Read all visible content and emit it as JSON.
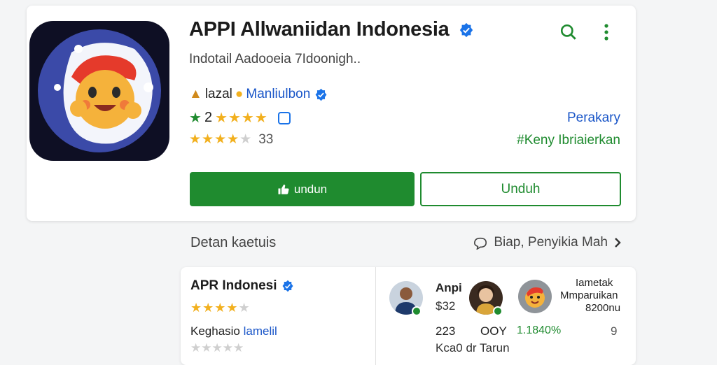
{
  "app": {
    "title": "APPI Allwaniidan Indonesia",
    "subtitle": "Indotail  Aadooeia  7Idoonigh..",
    "developer_prefix": "lazal",
    "developer_name": "Manliulbon",
    "rating_value": "2",
    "rating_stars": "★★★★",
    "rating2_stars": "★★★★",
    "rating2_empty": "★",
    "rating2_count": "33",
    "link_top": "Perakary",
    "link_bottom": "#Keny Ibriaierkan"
  },
  "buttons": {
    "primary": "undun",
    "secondary": "Unduh"
  },
  "section": {
    "title": "Detan kaetuis",
    "link": "Biap, Penyikia Mah"
  },
  "related": {
    "title": "APR Indonesi",
    "stars": "★★★★",
    "stars_empty": "★",
    "label_prefix": "Keghasio",
    "label_blue": "lamelil",
    "stars2": "★★★★★",
    "p1_name": "Anpi",
    "p1_value": "$32",
    "p1_stat": "223",
    "p1_stat2": "OOY",
    "p1_stat3": "1.1840%",
    "p1_footer": "Kca0  dr Tarun",
    "p3_line1": "Iametak",
    "p3_line2": "Mmparuikan",
    "p3_line3": "8200nu",
    "p3_stat": "9"
  },
  "colors": {
    "green": "#1f8b2f",
    "blue": "#1a56c8",
    "star": "#f2b01e"
  },
  "icons": [
    "verified-icon",
    "search-icon",
    "more-vert-icon",
    "thumbs-up-icon",
    "chevron-right-icon",
    "share-icon"
  ]
}
